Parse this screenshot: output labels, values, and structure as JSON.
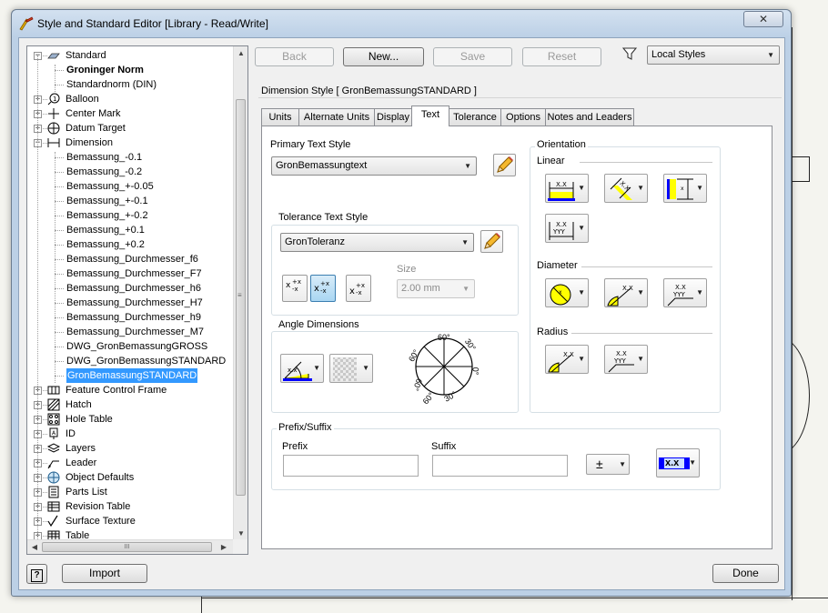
{
  "window": {
    "title": "Style and Standard Editor [Library - Read/Write]",
    "close_label": "✕"
  },
  "tree": {
    "items": [
      {
        "label": "Standard",
        "level": 0,
        "expander": "−",
        "icon": "standard-icon"
      },
      {
        "label": "Groninger Norm",
        "level": 1,
        "bold": true
      },
      {
        "label": "Standardnorm (DIN)",
        "level": 1
      },
      {
        "label": "Balloon",
        "level": 0,
        "expander": "+",
        "icon": "balloon-icon"
      },
      {
        "label": "Center Mark",
        "level": 0,
        "expander": "+",
        "icon": "center-mark-icon"
      },
      {
        "label": "Datum Target",
        "level": 0,
        "expander": "+",
        "icon": "datum-target-icon"
      },
      {
        "label": "Dimension",
        "level": 0,
        "expander": "−",
        "icon": "dimension-icon"
      },
      {
        "label": "Bemassung_-0.1",
        "level": 1
      },
      {
        "label": "Bemassung_-0.2",
        "level": 1
      },
      {
        "label": "Bemassung_+-0.05",
        "level": 1
      },
      {
        "label": "Bemassung_+-0.1",
        "level": 1
      },
      {
        "label": "Bemassung_+-0.2",
        "level": 1
      },
      {
        "label": "Bemassung_+0.1",
        "level": 1
      },
      {
        "label": "Bemassung_+0.2",
        "level": 1
      },
      {
        "label": "Bemassung_Durchmesser_f6",
        "level": 1
      },
      {
        "label": "Bemassung_Durchmesser_F7",
        "level": 1
      },
      {
        "label": "Bemassung_Durchmesser_h6",
        "level": 1
      },
      {
        "label": "Bemassung_Durchmesser_H7",
        "level": 1
      },
      {
        "label": "Bemassung_Durchmesser_h9",
        "level": 1
      },
      {
        "label": "Bemassung_Durchmesser_M7",
        "level": 1
      },
      {
        "label": "DWG_GronBemassungGROSS",
        "level": 1
      },
      {
        "label": "DWG_GronBemassungSTANDARD",
        "level": 1
      },
      {
        "label": "GronBemassungSTANDARD",
        "level": 1,
        "selected": true
      },
      {
        "label": "Feature Control Frame",
        "level": 0,
        "expander": "+",
        "icon": "feature-control-frame-icon"
      },
      {
        "label": "Hatch",
        "level": 0,
        "expander": "+",
        "icon": "hatch-icon"
      },
      {
        "label": "Hole Table",
        "level": 0,
        "expander": "+",
        "icon": "hole-table-icon"
      },
      {
        "label": "ID",
        "level": 0,
        "expander": "+",
        "icon": "id-icon"
      },
      {
        "label": "Layers",
        "level": 0,
        "expander": "+",
        "icon": "layers-icon"
      },
      {
        "label": "Leader",
        "level": 0,
        "expander": "+",
        "icon": "leader-icon"
      },
      {
        "label": "Object Defaults",
        "level": 0,
        "expander": "+",
        "icon": "object-defaults-icon"
      },
      {
        "label": "Parts List",
        "level": 0,
        "expander": "+",
        "icon": "parts-list-icon"
      },
      {
        "label": "Revision Table",
        "level": 0,
        "expander": "+",
        "icon": "revision-table-icon"
      },
      {
        "label": "Surface Texture",
        "level": 0,
        "expander": "+",
        "icon": "surface-texture-icon"
      },
      {
        "label": "Table",
        "level": 0,
        "expander": "+",
        "icon": "table-icon"
      }
    ],
    "hscroll_grip": "III",
    "vscroll_grip": "≡"
  },
  "toolbar": {
    "back": "Back",
    "new": "New...",
    "save": "Save",
    "reset": "Reset",
    "filter_icon": "filter-icon",
    "filter_value": "Local Styles"
  },
  "style_header": "Dimension Style [ GronBemassungSTANDARD ]",
  "tabs": [
    "Units",
    "Alternate Units",
    "Display",
    "Text",
    "Tolerance",
    "Options",
    "Notes and Leaders"
  ],
  "active_tab": "Text",
  "text_tab": {
    "primary_text_style_label": "Primary Text Style",
    "primary_text_style_value": "GronBemassungtext",
    "tolerance_text_style_label": "Tolerance Text Style",
    "tolerance_text_style_value": "GronToleranz",
    "size_label": "Size",
    "size_value": "2.00 mm",
    "angle_dimensions_label": "Angle Dimensions",
    "angle_marks": [
      "60°",
      "30°",
      "60°",
      "0°",
      "60°",
      "30°",
      "60°"
    ],
    "prefix_suffix_label": "Prefix/Suffix",
    "prefix_label": "Prefix",
    "prefix_value": "",
    "suffix_label": "Suffix",
    "suffix_value": "",
    "plusminus_symbol": "±",
    "orientation_label": "Orientation",
    "linear_label": "Linear",
    "diameter_label": "Diameter",
    "radius_label": "Radius",
    "xx_text": "x.x",
    "xx_mark": "X.X",
    "yyy_mark": "YYY"
  },
  "footer": {
    "help": "?",
    "import": "Import",
    "done": "Done"
  },
  "colors": {
    "accent_selection": "#3399ff",
    "icon_yellow": "#ffff00",
    "icon_blue": "#0000ff"
  }
}
